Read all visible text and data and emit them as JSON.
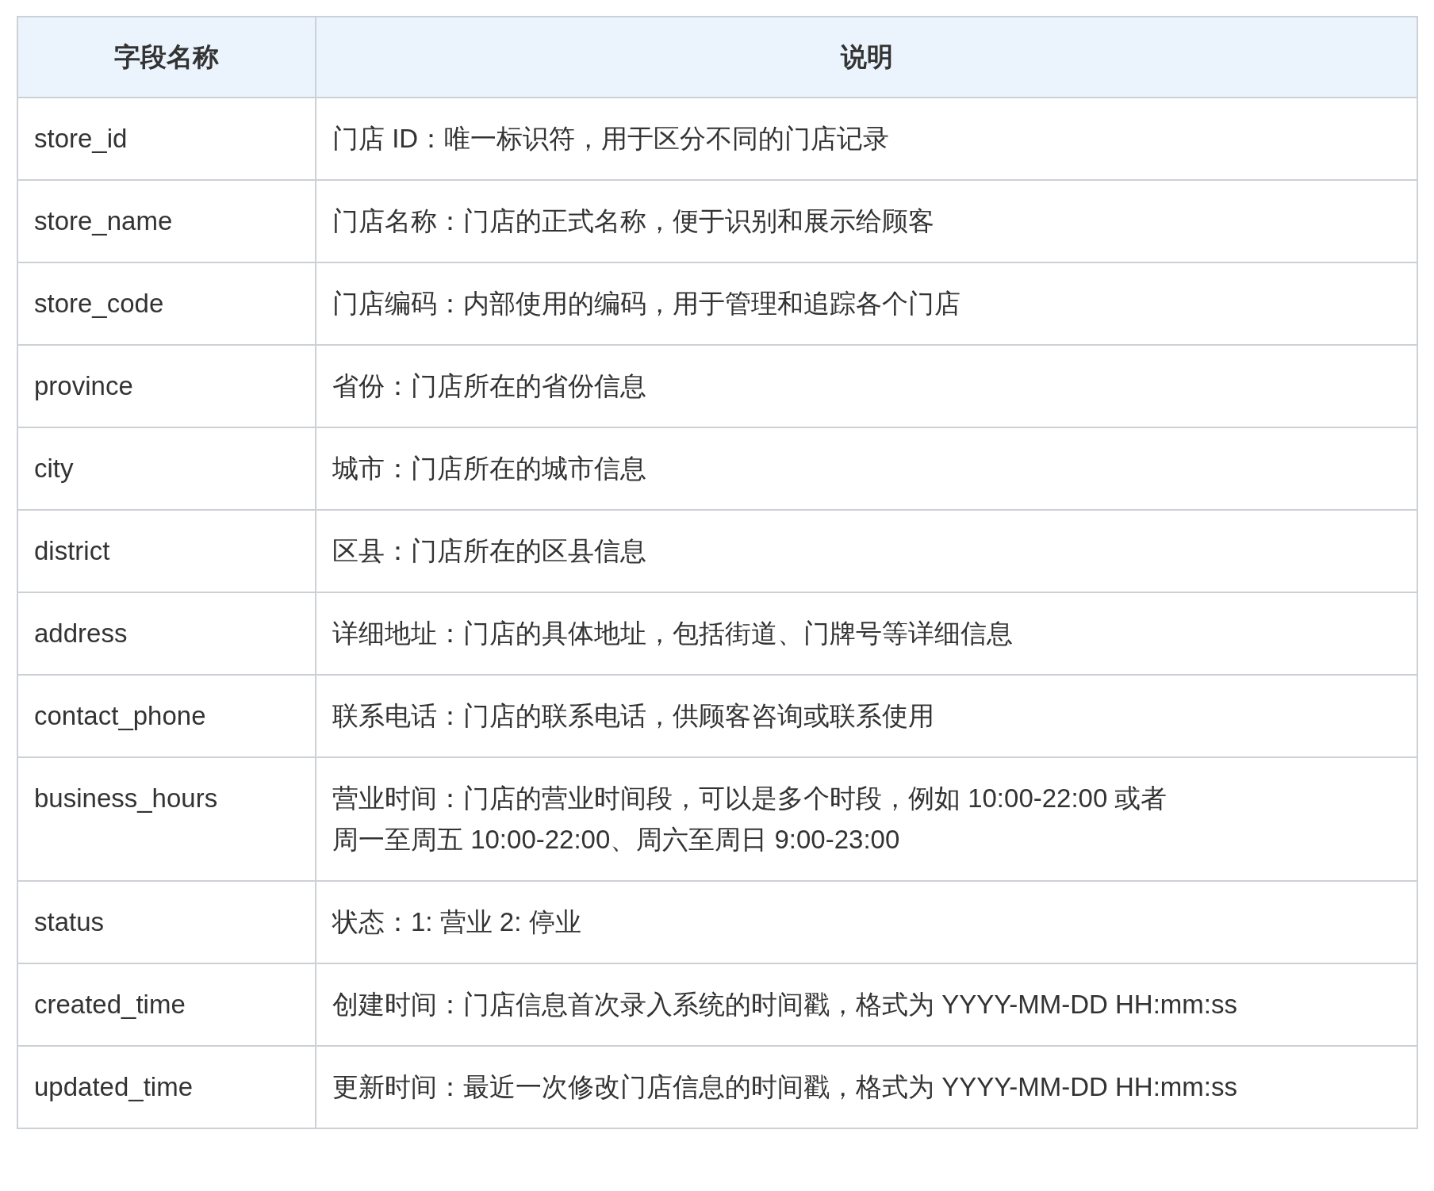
{
  "table": {
    "columns": [
      "字段名称",
      "说明"
    ],
    "rows": [
      {
        "field": "store_id",
        "description": [
          "门店 ID：唯一标识符，用于区分不同的门店记录"
        ]
      },
      {
        "field": "store_name",
        "description": [
          "门店名称：门店的正式名称，便于识别和展示给顾客"
        ]
      },
      {
        "field": "store_code",
        "description": [
          "门店编码：内部使用的编码，用于管理和追踪各个门店"
        ]
      },
      {
        "field": "province",
        "description": [
          "省份：门店所在的省份信息"
        ]
      },
      {
        "field": "city",
        "description": [
          "城市：门店所在的城市信息"
        ]
      },
      {
        "field": "district",
        "description": [
          "区县：门店所在的区县信息"
        ]
      },
      {
        "field": "address",
        "description": [
          "详细地址：门店的具体地址，包括街道、门牌号等详细信息"
        ]
      },
      {
        "field": "contact_phone",
        "description": [
          "联系电话：门店的联系电话，供顾客咨询或联系使用"
        ]
      },
      {
        "field": "business_hours",
        "description": [
          "营业时间：门店的营业时间段，可以是多个时段，例如 10:00-22:00 或者",
          "周一至周五 10:00-22:00、周六至周日 9:00-23:00"
        ]
      },
      {
        "field": "status",
        "description": [
          "状态：1: 营业 2: 停业"
        ]
      },
      {
        "field": "created_time",
        "description": [
          "创建时间：门店信息首次录入系统的时间戳，格式为 YYYY-MM-DD HH:mm:ss"
        ]
      },
      {
        "field": "updated_time",
        "description": [
          "更新时间：最近一次修改门店信息的时间戳，格式为 YYYY-MM-DD HH:mm:ss"
        ]
      }
    ]
  }
}
